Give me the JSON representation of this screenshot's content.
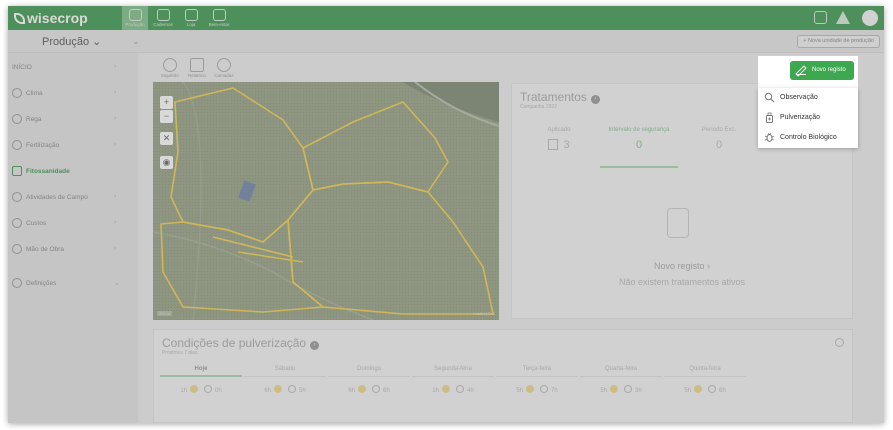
{
  "app": {
    "logo": "wisecrop"
  },
  "topnav": {
    "tabs": [
      {
        "label": "Produção",
        "icon": "farm-icon",
        "active": true
      },
      {
        "label": "Cadernos",
        "icon": "notebook-icon",
        "active": false
      },
      {
        "label": "Loja",
        "icon": "shop-icon",
        "active": false
      },
      {
        "label": "Bem-estar",
        "icon": "tools-icon",
        "active": false
      }
    ]
  },
  "subbar": {
    "unit": "Produção ⌄",
    "new_unit_button": "+ Nova unidade de produção"
  },
  "sidebar": {
    "items": [
      {
        "label": "INÍCIO",
        "icon": "",
        "head": true
      },
      {
        "label": "Clima",
        "icon": "cloud-icon"
      },
      {
        "label": "Rega",
        "icon": "drop-icon"
      },
      {
        "label": "Fertilização",
        "icon": "fertilizer-icon"
      },
      {
        "label": "Fitossanidade",
        "icon": "plant-health-icon",
        "active": true
      },
      {
        "label": "Atividades de Campo",
        "icon": "calendar-icon"
      },
      {
        "label": "Custos",
        "icon": "coins-icon"
      },
      {
        "label": "Mão de Obra",
        "icon": "worker-icon"
      },
      {
        "label": "Definições",
        "icon": "settings-icon"
      }
    ]
  },
  "map_tools": [
    {
      "label": "Inquérito",
      "icon": "survey-icon"
    },
    {
      "label": "Relatório",
      "icon": "report-icon"
    },
    {
      "label": "Camadas",
      "icon": "layers-icon"
    }
  ],
  "map_controls": [
    {
      "label": "+",
      "name": "zoom-in-button"
    },
    {
      "label": "−",
      "name": "zoom-out-button"
    },
    {
      "label": "✕",
      "name": "fullscreen-button"
    },
    {
      "label": "◉",
      "name": "locate-button"
    }
  ],
  "map": {
    "scale_label": "500 m",
    "attribution": "Leaflet | Esri"
  },
  "treatments": {
    "title": "Tratamentos",
    "subtitle": "Campanha 2022",
    "columns": [
      {
        "header": "Aplicado",
        "value": "3"
      },
      {
        "header": "Intervalo de segurança",
        "value": "0",
        "selected": true
      },
      {
        "header": "Período Exc.",
        "value": "0"
      },
      {
        "header": "",
        "value": "0"
      }
    ],
    "empty_link": "Novo registo ›",
    "empty_text": "Não existem tratamentos ativos"
  },
  "spray": {
    "title": "Condições de pulverização",
    "subtitle": "Próximos 7 dias",
    "days": [
      {
        "label": "Hoje",
        "day": "1h",
        "night": "0h",
        "selected": true
      },
      {
        "label": "Sábado",
        "day": "6h",
        "night": "5h"
      },
      {
        "label": "Domingo",
        "day": "6h",
        "night": "6h"
      },
      {
        "label": "Segunda-feira",
        "day": "1h",
        "night": "4h"
      },
      {
        "label": "Terça-feira",
        "day": "5h",
        "night": "7h"
      },
      {
        "label": "Quarta-feira",
        "day": "5h",
        "night": "3h"
      },
      {
        "label": "Quinta-feira",
        "day": "5h",
        "night": "6h"
      }
    ]
  },
  "new_record": {
    "button": "Novo registo",
    "menu": [
      {
        "label": "Observação",
        "icon": "magnifier-icon"
      },
      {
        "label": "Pulverização",
        "icon": "sprayer-icon"
      },
      {
        "label": "Controlo Biológico",
        "icon": "bug-icon"
      }
    ]
  },
  "colors": {
    "brand_green": "#3f9a52",
    "button_green": "#3da84f",
    "field_outline": "#f2d04c"
  }
}
